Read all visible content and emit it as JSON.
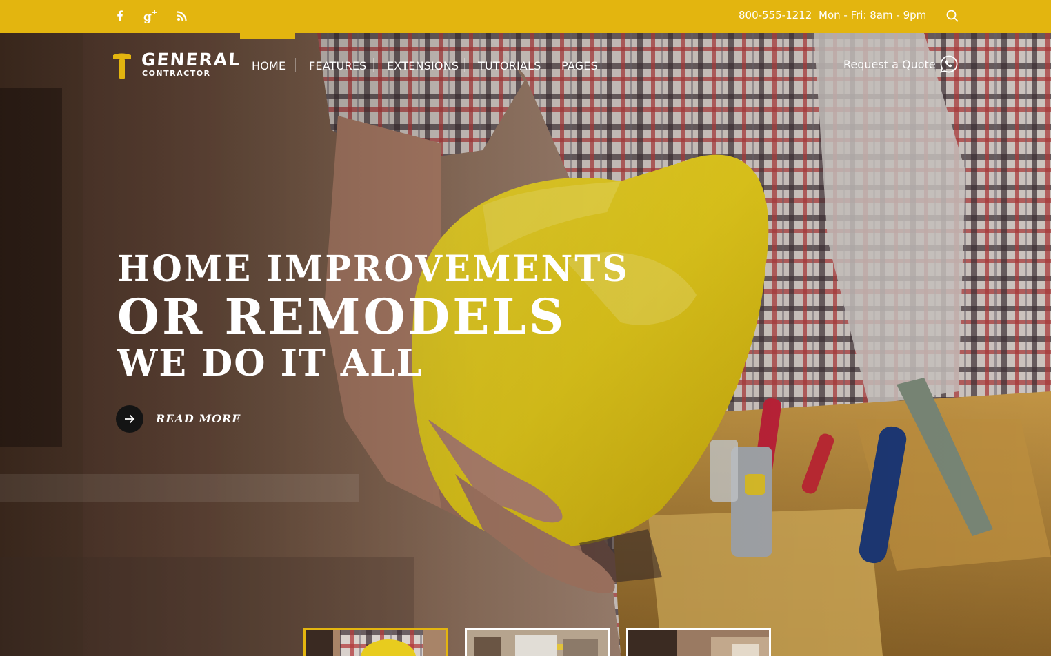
{
  "topbar": {
    "social": [
      {
        "name": "facebook",
        "icon": "facebook-icon"
      },
      {
        "name": "google-plus",
        "icon": "google-plus-icon"
      },
      {
        "name": "rss",
        "icon": "rss-icon"
      }
    ],
    "phone": "800-555-1212",
    "hours": "Mon - Fri: 8am - 9pm",
    "search_icon": "search-icon"
  },
  "brand": {
    "line1": "General",
    "line2": "Contractor",
    "icon": "hammer-icon"
  },
  "nav": {
    "items": [
      {
        "label": "HOME",
        "active": true
      },
      {
        "label": "FEATURES"
      },
      {
        "label": "EXTENSIONS"
      },
      {
        "label": "TUTORIALS"
      },
      {
        "label": "PAGES"
      }
    ]
  },
  "quote": {
    "label": "Request a Quote",
    "icon": "phone-bubble-icon"
  },
  "hero": {
    "line1": "Home Improvements",
    "line2": "or Remodels",
    "line3": "We do it all",
    "read_more": "Read More",
    "read_more_icon": "arrow-right-icon"
  },
  "thumbnails": [
    {
      "name": "slide-1",
      "active": true
    },
    {
      "name": "slide-2"
    },
    {
      "name": "slide-3"
    }
  ],
  "colors": {
    "accent": "#e3b50f",
    "text": "#ffffff",
    "button": "#141414"
  }
}
